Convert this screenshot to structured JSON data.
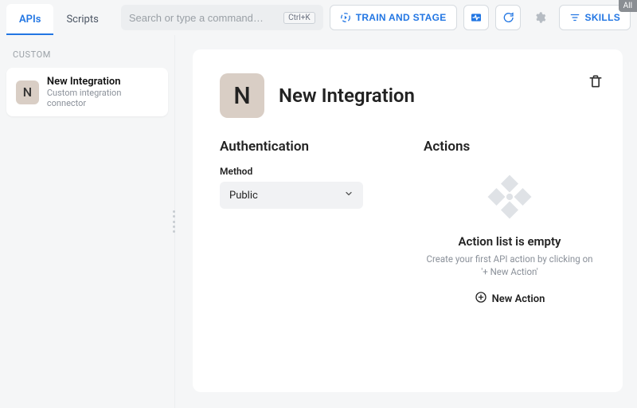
{
  "corner_tag": "All",
  "tabs": {
    "apis": "APIs",
    "scripts": "Scripts"
  },
  "search": {
    "placeholder": "Search or type a command…",
    "shortcut": "Ctrl+K"
  },
  "topbar": {
    "train": "TRAIN AND STAGE",
    "skills": "SKILLS"
  },
  "sidebar": {
    "section": "CUSTOM",
    "item": {
      "initial": "N",
      "title": "New Integration",
      "subtitle": "Custom integration connector"
    }
  },
  "panel": {
    "initial": "N",
    "title": "New Integration",
    "auth": {
      "heading": "Authentication",
      "method_label": "Method",
      "method_value": "Public"
    },
    "actions": {
      "heading": "Actions",
      "empty_title": "Action list is empty",
      "empty_sub": "Create your first API action by clicking on '+ New Action'",
      "new_action": "New Action"
    }
  }
}
